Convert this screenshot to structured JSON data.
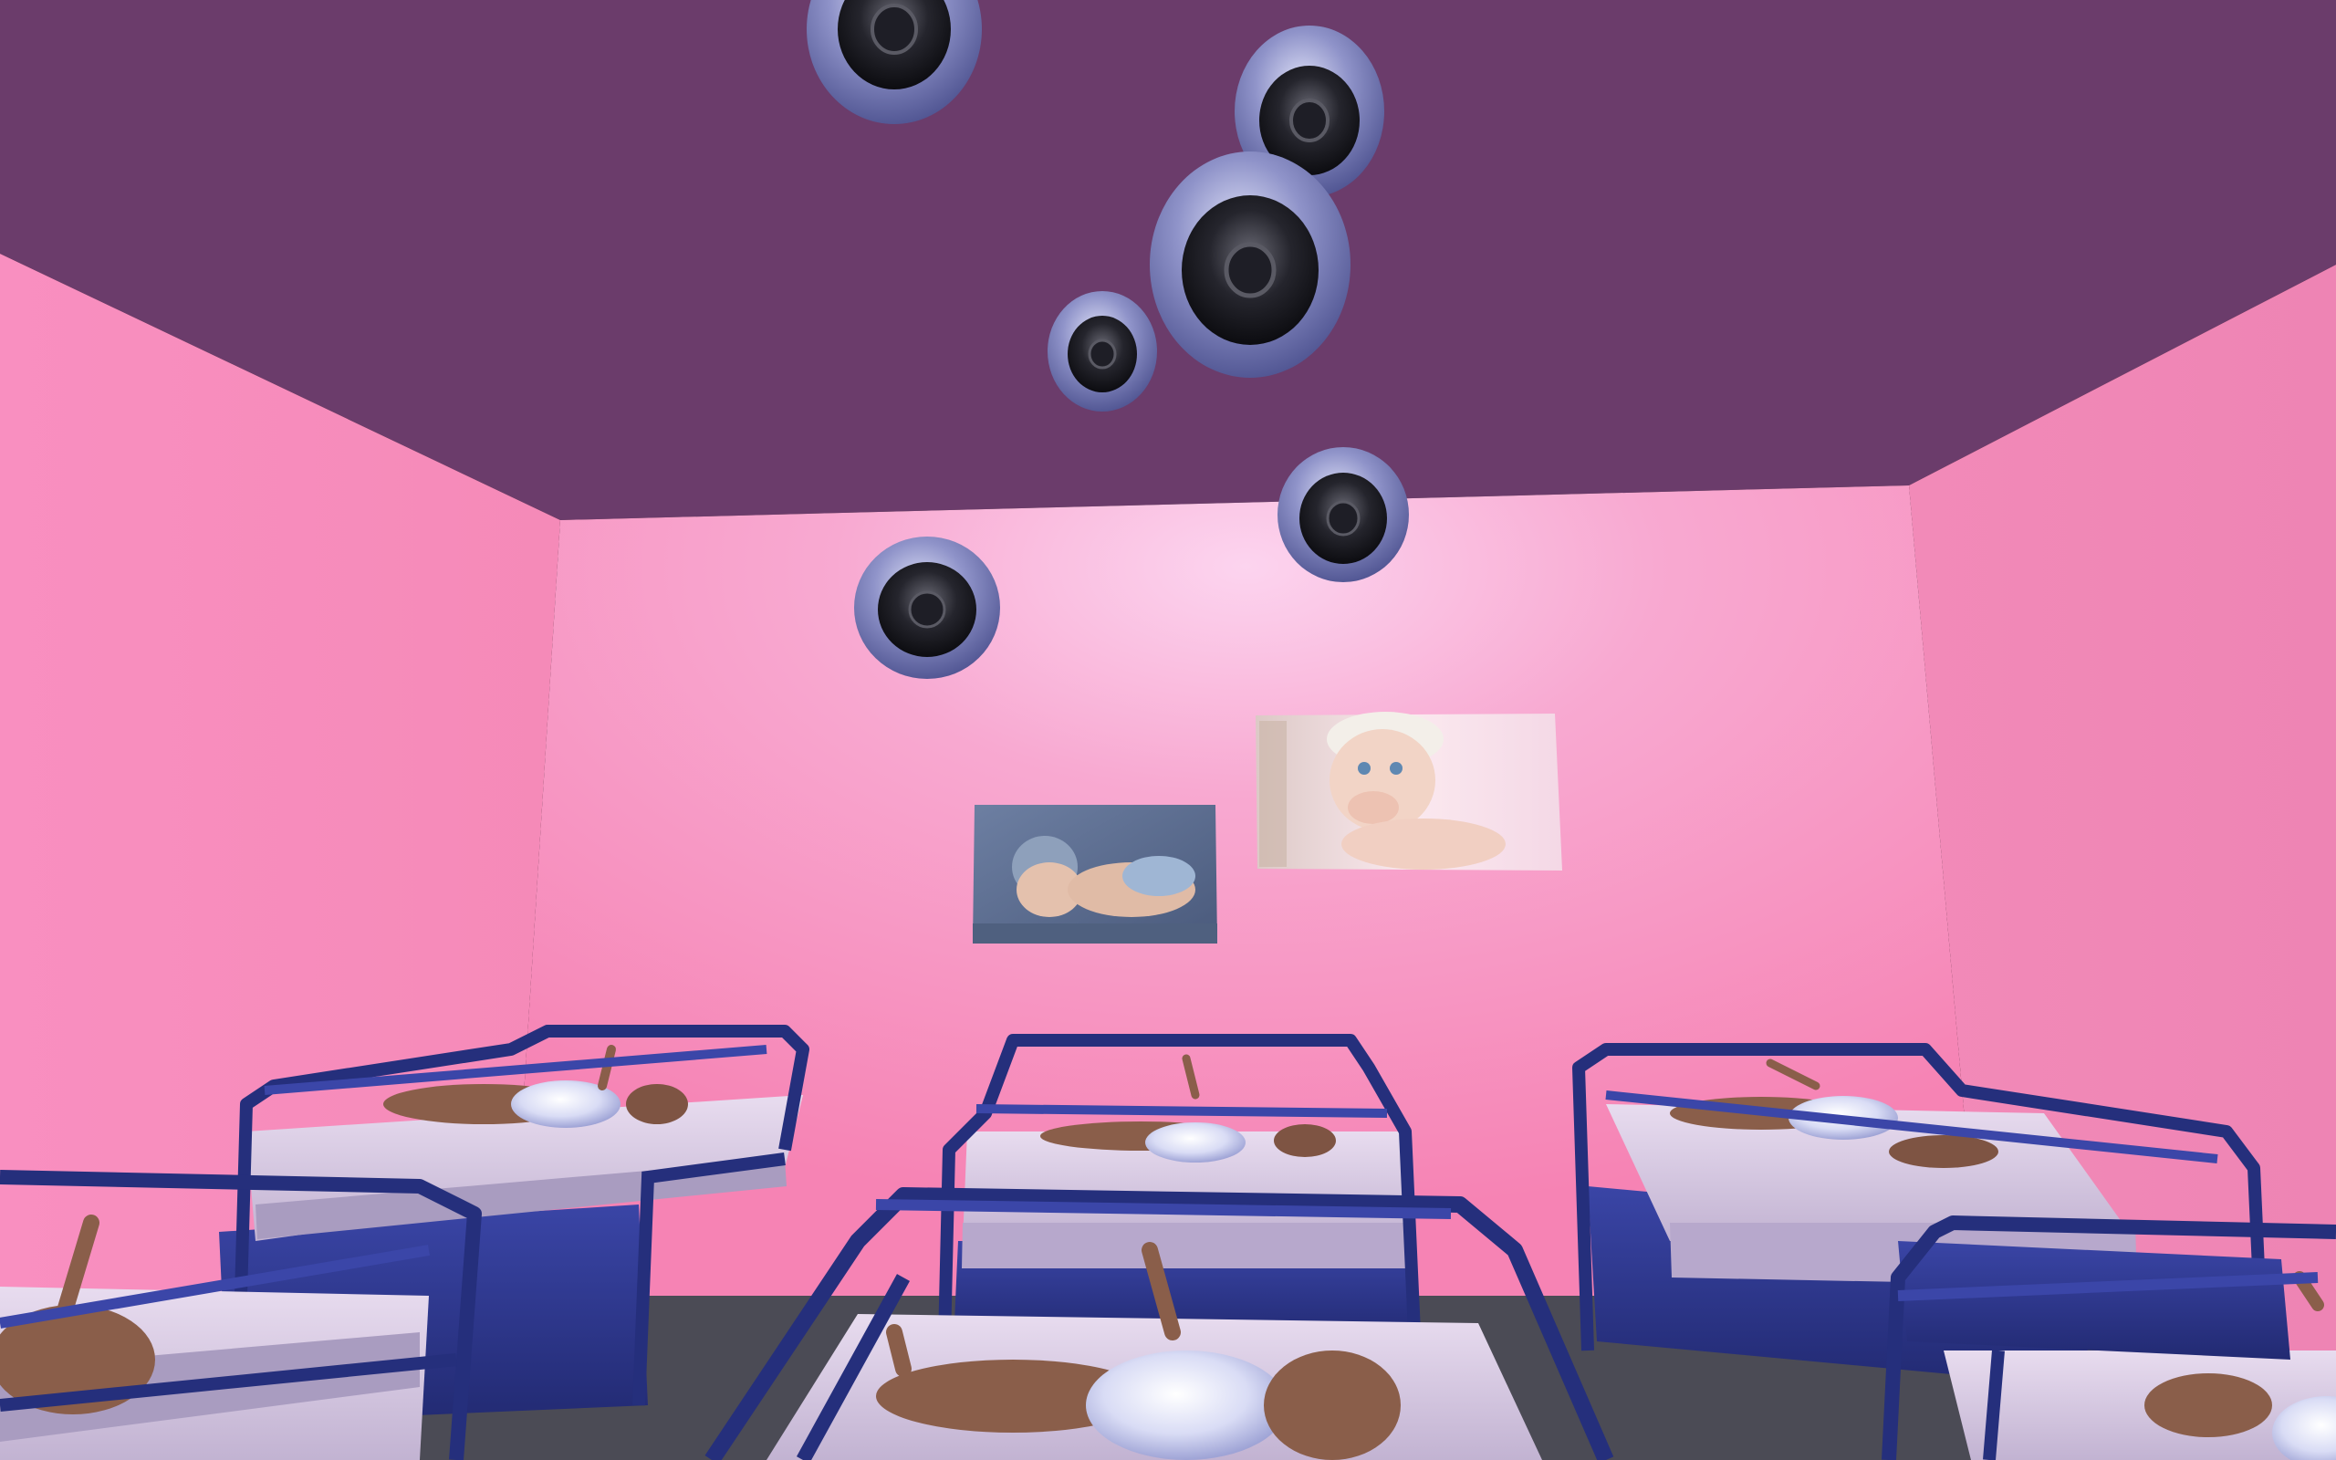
{
  "scene": {
    "type": "3d-room",
    "room": "nursery",
    "colors": {
      "ceiling": "#6b3c6b",
      "back_wall": "#f78cba",
      "back_wall_glow": "#fcd4ef",
      "side_wall": "#f589b9",
      "floor": "#4b4b55",
      "crib_frame": "#252f7c",
      "crib_frame_highlight": "#3b46a8",
      "mattress": "#d9c8e4",
      "crib_base": "#283184",
      "baby_skin": "#8a5e4a",
      "diaper": "#dfe3fb",
      "speaker_outer": "#7d81b8",
      "speaker_cone": "#111118"
    },
    "objects": {
      "speakers": [
        {
          "name": "ceiling-speaker-1"
        },
        {
          "name": "ceiling-speaker-2"
        },
        {
          "name": "ceiling-speaker-3"
        },
        {
          "name": "ceiling-speaker-4"
        },
        {
          "name": "ceiling-speaker-5"
        },
        {
          "name": "ceiling-speaker-6"
        }
      ],
      "wall_pictures": [
        {
          "name": "sleeping-baby-picture"
        },
        {
          "name": "smiling-baby-picture"
        }
      ],
      "cribs": [
        {
          "name": "crib-back-left"
        },
        {
          "name": "crib-back-center"
        },
        {
          "name": "crib-back-right"
        },
        {
          "name": "crib-front-left"
        },
        {
          "name": "crib-front-center"
        },
        {
          "name": "crib-front-right"
        }
      ]
    }
  }
}
